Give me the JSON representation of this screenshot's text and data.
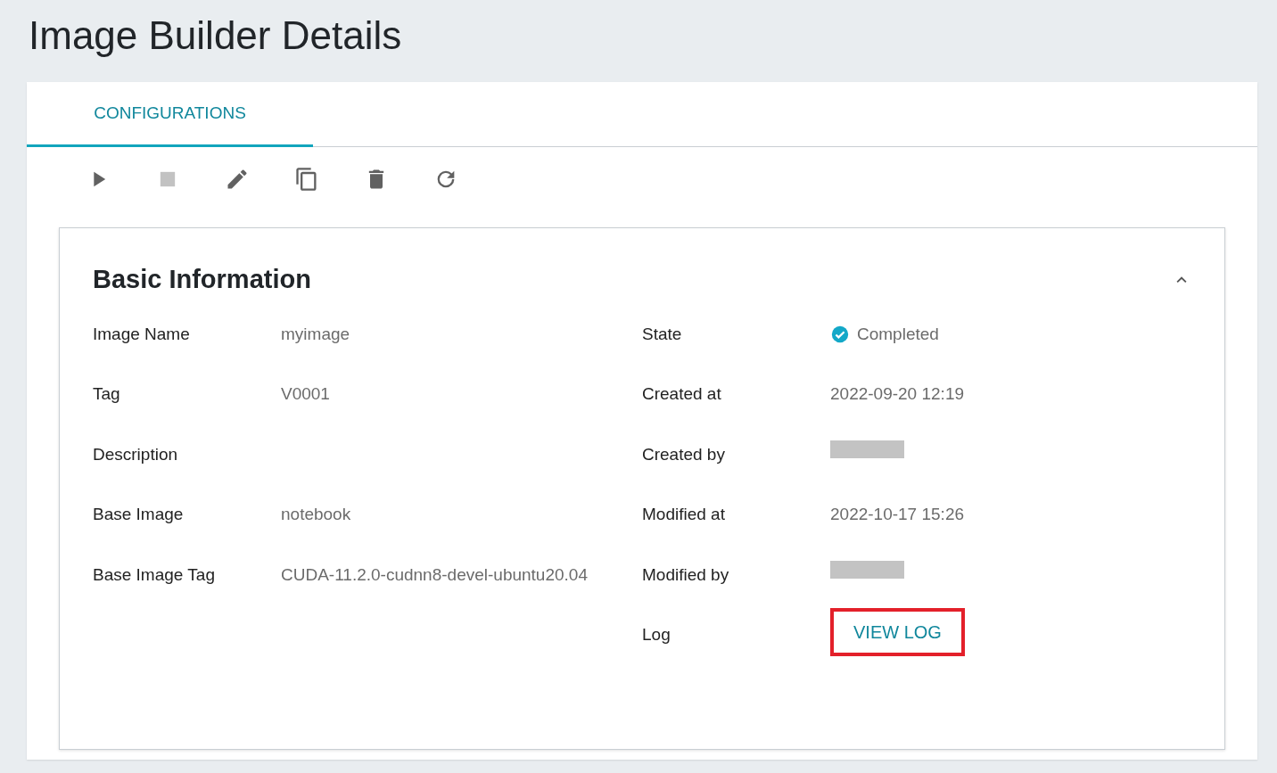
{
  "page": {
    "title": "Image Builder Details"
  },
  "tabs": [
    {
      "label": "CONFIGURATIONS",
      "selected": true
    }
  ],
  "toolbar": [
    {
      "kind": "start",
      "disabled": false
    },
    {
      "kind": "stop",
      "disabled": true
    },
    {
      "kind": "edit",
      "disabled": false
    },
    {
      "kind": "copy",
      "disabled": false
    },
    {
      "kind": "delete",
      "disabled": false
    },
    {
      "kind": "refresh",
      "disabled": false
    }
  ],
  "section": {
    "title": "Basic Information",
    "expanded": true,
    "left_fields": [
      {
        "label": "Image Name",
        "kind": "text",
        "value": "myimage"
      },
      {
        "label": "Tag",
        "kind": "text",
        "value": "V0001"
      },
      {
        "label": "Description",
        "kind": "empty"
      },
      {
        "label": "Base Image",
        "kind": "text",
        "value": "notebook"
      },
      {
        "label": "Base Image Tag",
        "kind": "text",
        "value": "CUDA-11.2.0-cudnn8-devel-ubuntu20.04"
      }
    ],
    "right_fields": [
      {
        "label": "State",
        "kind": "status",
        "value": "Completed"
      },
      {
        "label": "Created at",
        "kind": "text",
        "value": "2022-09-20 12:19"
      },
      {
        "label": "Created by",
        "kind": "redacted"
      },
      {
        "label": "Modified at",
        "kind": "text",
        "value": "2022-10-17 15:26"
      },
      {
        "label": "Modified by",
        "kind": "redacted"
      },
      {
        "label": "Log",
        "kind": "link",
        "value": "VIEW LOG",
        "highlighted": true
      }
    ]
  }
}
